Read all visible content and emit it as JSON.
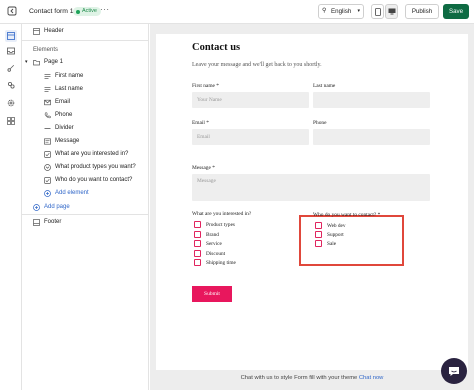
{
  "topbar": {
    "back_icon": "back-arrow-icon",
    "title": "Contact form 1",
    "status": "Active",
    "more": "···",
    "language": "English",
    "publish": "Publish",
    "save": "Save"
  },
  "rail": {
    "icons": [
      "layout-icon",
      "inbox-icon",
      "paint-brush-icon",
      "integrations-icon",
      "settings-icon",
      "apps-icon"
    ]
  },
  "panel": {
    "header": "Header",
    "elements_title": "Elements",
    "page": "Page 1",
    "elements": [
      {
        "label": "First name",
        "icon": "text-field-icon"
      },
      {
        "label": "Last name",
        "icon": "text-field-icon"
      },
      {
        "label": "Email",
        "icon": "mail-icon"
      },
      {
        "label": "Phone",
        "icon": "phone-icon"
      },
      {
        "label": "Divider",
        "icon": "divider-icon"
      },
      {
        "label": "Message",
        "icon": "message-icon"
      },
      {
        "label": "What are you interested in?",
        "icon": "checkbox-icon"
      },
      {
        "label": "What product types you want?",
        "icon": "dropdown-icon"
      },
      {
        "label": "Who do you want to contact?",
        "icon": "checkbox-icon"
      }
    ],
    "add_element": "Add element",
    "add_page": "Add page",
    "footer": "Footer"
  },
  "form": {
    "title": "Contact us",
    "subtitle": "Leave your message and we'll get back to you shortly.",
    "first_name_label": "First name *",
    "first_name_placeholder": "Your Name",
    "last_name_label": "Last name",
    "email_label": "Email *",
    "email_placeholder": "Email",
    "phone_label": "Phone",
    "message_label": "Message *",
    "message_placeholder": "Message",
    "interest_label": "What are you interested in?",
    "interest_options": [
      "Product types",
      "Brand",
      "Service",
      "Discount",
      "Shipping time"
    ],
    "contact_label": "Who do you want to contact? *",
    "contact_options": [
      "Web dev",
      "Support",
      "Sale"
    ],
    "submit": "Submit"
  },
  "footer": {
    "text": "Chat with us to style Form fill with your theme",
    "link": "Chat now"
  },
  "colors": {
    "save": "#0e6b43",
    "submit": "#e8175d",
    "highlight": "#e0473b",
    "link": "#2f66c8"
  }
}
